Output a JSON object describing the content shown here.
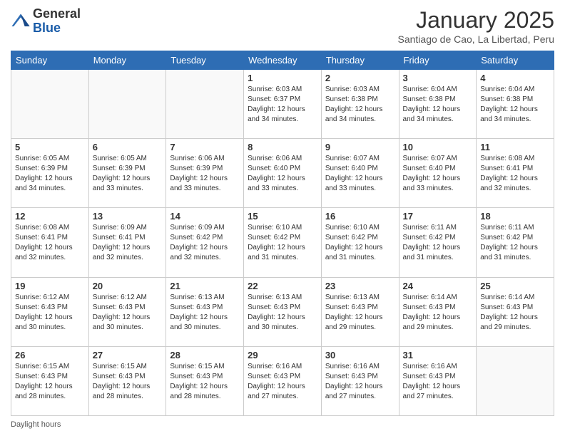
{
  "logo": {
    "general": "General",
    "blue": "Blue"
  },
  "header": {
    "month_title": "January 2025",
    "subtitle": "Santiago de Cao, La Libertad, Peru"
  },
  "days_of_week": [
    "Sunday",
    "Monday",
    "Tuesday",
    "Wednesday",
    "Thursday",
    "Friday",
    "Saturday"
  ],
  "footer": {
    "daylight_label": "Daylight hours"
  },
  "weeks": [
    {
      "cells": [
        {
          "day": null,
          "content": ""
        },
        {
          "day": null,
          "content": ""
        },
        {
          "day": null,
          "content": ""
        },
        {
          "day": "1",
          "content": "Sunrise: 6:03 AM\nSunset: 6:37 PM\nDaylight: 12 hours\nand 34 minutes."
        },
        {
          "day": "2",
          "content": "Sunrise: 6:03 AM\nSunset: 6:38 PM\nDaylight: 12 hours\nand 34 minutes."
        },
        {
          "day": "3",
          "content": "Sunrise: 6:04 AM\nSunset: 6:38 PM\nDaylight: 12 hours\nand 34 minutes."
        },
        {
          "day": "4",
          "content": "Sunrise: 6:04 AM\nSunset: 6:38 PM\nDaylight: 12 hours\nand 34 minutes."
        }
      ]
    },
    {
      "cells": [
        {
          "day": "5",
          "content": "Sunrise: 6:05 AM\nSunset: 6:39 PM\nDaylight: 12 hours\nand 34 minutes."
        },
        {
          "day": "6",
          "content": "Sunrise: 6:05 AM\nSunset: 6:39 PM\nDaylight: 12 hours\nand 33 minutes."
        },
        {
          "day": "7",
          "content": "Sunrise: 6:06 AM\nSunset: 6:39 PM\nDaylight: 12 hours\nand 33 minutes."
        },
        {
          "day": "8",
          "content": "Sunrise: 6:06 AM\nSunset: 6:40 PM\nDaylight: 12 hours\nand 33 minutes."
        },
        {
          "day": "9",
          "content": "Sunrise: 6:07 AM\nSunset: 6:40 PM\nDaylight: 12 hours\nand 33 minutes."
        },
        {
          "day": "10",
          "content": "Sunrise: 6:07 AM\nSunset: 6:40 PM\nDaylight: 12 hours\nand 33 minutes."
        },
        {
          "day": "11",
          "content": "Sunrise: 6:08 AM\nSunset: 6:41 PM\nDaylight: 12 hours\nand 32 minutes."
        }
      ]
    },
    {
      "cells": [
        {
          "day": "12",
          "content": "Sunrise: 6:08 AM\nSunset: 6:41 PM\nDaylight: 12 hours\nand 32 minutes."
        },
        {
          "day": "13",
          "content": "Sunrise: 6:09 AM\nSunset: 6:41 PM\nDaylight: 12 hours\nand 32 minutes."
        },
        {
          "day": "14",
          "content": "Sunrise: 6:09 AM\nSunset: 6:42 PM\nDaylight: 12 hours\nand 32 minutes."
        },
        {
          "day": "15",
          "content": "Sunrise: 6:10 AM\nSunset: 6:42 PM\nDaylight: 12 hours\nand 31 minutes."
        },
        {
          "day": "16",
          "content": "Sunrise: 6:10 AM\nSunset: 6:42 PM\nDaylight: 12 hours\nand 31 minutes."
        },
        {
          "day": "17",
          "content": "Sunrise: 6:11 AM\nSunset: 6:42 PM\nDaylight: 12 hours\nand 31 minutes."
        },
        {
          "day": "18",
          "content": "Sunrise: 6:11 AM\nSunset: 6:42 PM\nDaylight: 12 hours\nand 31 minutes."
        }
      ]
    },
    {
      "cells": [
        {
          "day": "19",
          "content": "Sunrise: 6:12 AM\nSunset: 6:43 PM\nDaylight: 12 hours\nand 30 minutes."
        },
        {
          "day": "20",
          "content": "Sunrise: 6:12 AM\nSunset: 6:43 PM\nDaylight: 12 hours\nand 30 minutes."
        },
        {
          "day": "21",
          "content": "Sunrise: 6:13 AM\nSunset: 6:43 PM\nDaylight: 12 hours\nand 30 minutes."
        },
        {
          "day": "22",
          "content": "Sunrise: 6:13 AM\nSunset: 6:43 PM\nDaylight: 12 hours\nand 30 minutes."
        },
        {
          "day": "23",
          "content": "Sunrise: 6:13 AM\nSunset: 6:43 PM\nDaylight: 12 hours\nand 29 minutes."
        },
        {
          "day": "24",
          "content": "Sunrise: 6:14 AM\nSunset: 6:43 PM\nDaylight: 12 hours\nand 29 minutes."
        },
        {
          "day": "25",
          "content": "Sunrise: 6:14 AM\nSunset: 6:43 PM\nDaylight: 12 hours\nand 29 minutes."
        }
      ]
    },
    {
      "cells": [
        {
          "day": "26",
          "content": "Sunrise: 6:15 AM\nSunset: 6:43 PM\nDaylight: 12 hours\nand 28 minutes."
        },
        {
          "day": "27",
          "content": "Sunrise: 6:15 AM\nSunset: 6:43 PM\nDaylight: 12 hours\nand 28 minutes."
        },
        {
          "day": "28",
          "content": "Sunrise: 6:15 AM\nSunset: 6:43 PM\nDaylight: 12 hours\nand 28 minutes."
        },
        {
          "day": "29",
          "content": "Sunrise: 6:16 AM\nSunset: 6:43 PM\nDaylight: 12 hours\nand 27 minutes."
        },
        {
          "day": "30",
          "content": "Sunrise: 6:16 AM\nSunset: 6:43 PM\nDaylight: 12 hours\nand 27 minutes."
        },
        {
          "day": "31",
          "content": "Sunrise: 6:16 AM\nSunset: 6:43 PM\nDaylight: 12 hours\nand 27 minutes."
        },
        {
          "day": null,
          "content": ""
        }
      ]
    }
  ]
}
